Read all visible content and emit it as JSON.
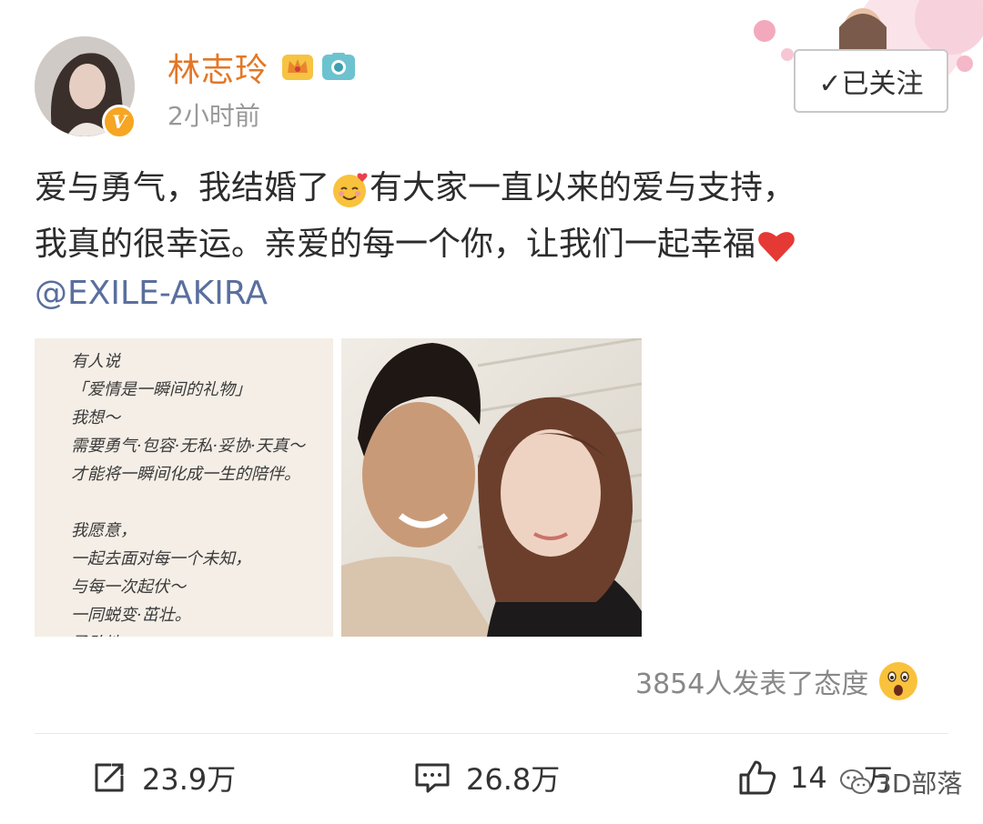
{
  "user": {
    "name": "林志玲",
    "time": "2小时前",
    "follow_label": "✓已关注"
  },
  "post": {
    "line1": "爱与勇气，我结婚了",
    "line1b": "有大家一直以来的爱与支持，",
    "line2": "我真的很幸运。亲爱的每一个你，让我们一起幸福",
    "mention": "@EXILE-AKIRA"
  },
  "letter": {
    "lines": [
      "有人说",
      "「爱情是一瞬间的礼物」",
      "我想～",
      "需要勇气·包容·无私·妥协·天真～",
      "才能将一瞬间化成一生的陪伴。",
      "",
      "我愿意，",
      "一起去面对每一个未知，",
      "与每一次起伏～",
      "一同蜕变·茁壮。",
      "勇敢地："
    ]
  },
  "reaction": {
    "text": "3854人发表了态度"
  },
  "actions": {
    "repost": "23.9万",
    "comment": "26.8万",
    "like": "14",
    "like_suffix": "万"
  },
  "watermark": {
    "text": "3D部落"
  },
  "colors": {
    "username": "#e37726",
    "mention": "#5a6f9e",
    "badge": "#f6a623"
  }
}
